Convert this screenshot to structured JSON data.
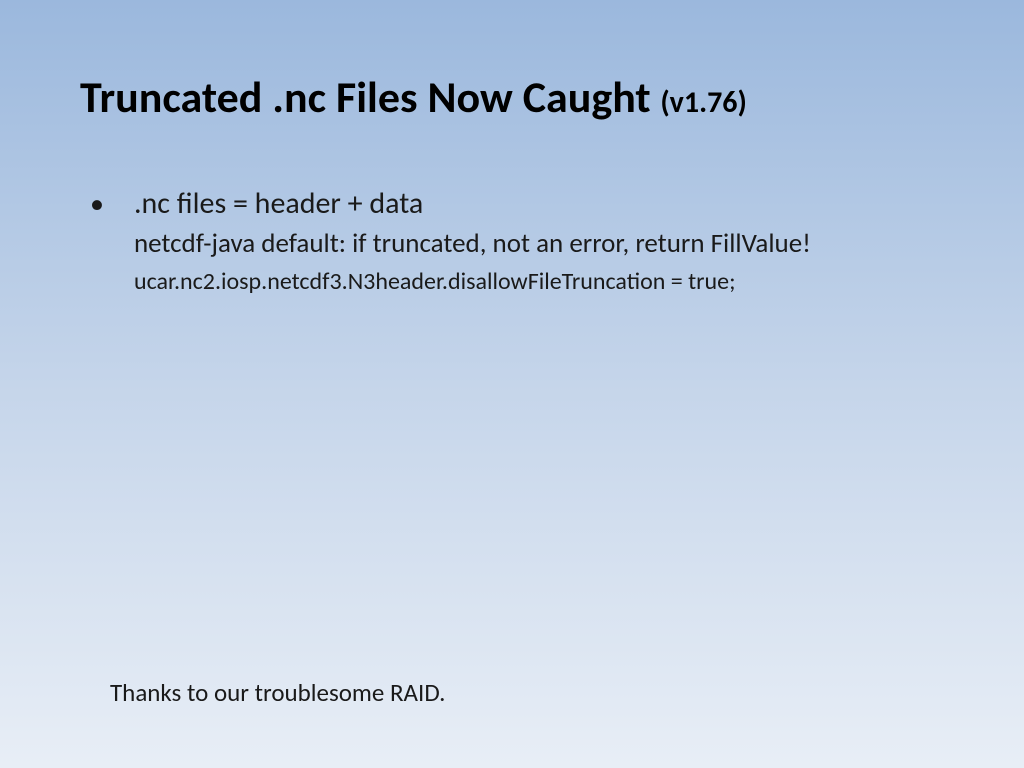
{
  "title": {
    "main": "Truncated .nc Files Now Caught",
    "version": "(v1.76)"
  },
  "content": {
    "bullet": "•",
    "line_main": ".nc files = header + data",
    "line_sub1": "netcdf-java default: if truncated, not an error, return FillValue!",
    "line_sub2": "ucar.nc2.iosp.netcdf3.N3header.disallowFileTruncation = true;"
  },
  "footer": {
    "note": "Thanks to our troublesome RAID."
  }
}
